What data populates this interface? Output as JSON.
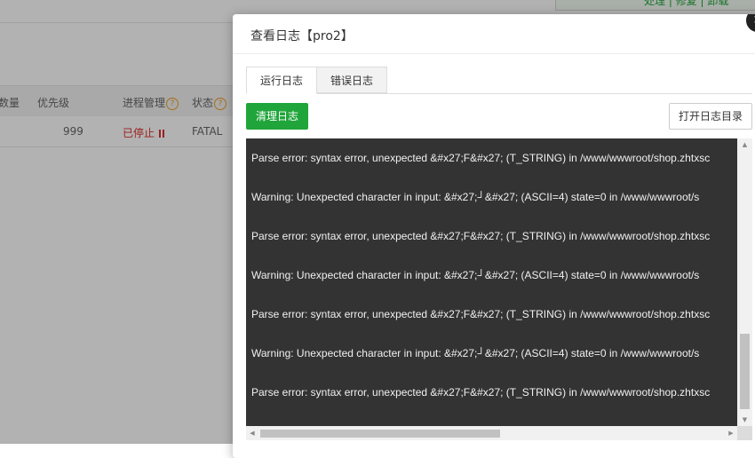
{
  "background": {
    "top_right_text": "处理 | 修复 | 卸载",
    "table": {
      "headers": [
        "数量",
        "优先级",
        "进程管理",
        "状态"
      ],
      "row": {
        "priority": "999",
        "process_status": "已停止",
        "state": "FATAL"
      }
    }
  },
  "modal": {
    "title": "查看日志【pro2】",
    "close_icon": "×",
    "tabs": [
      {
        "label": "运行日志",
        "active": true
      },
      {
        "label": "错误日志",
        "active": false
      }
    ],
    "clear_button": "清理日志",
    "open_dir_button": "打开日志目录",
    "log_lines": [
      "Parse error: syntax error, unexpected &#x27;F&#x27; (T_STRING) in /www/wwwroot/shop.zhtxsc",
      "Warning: Unexpected character in input:  &#x27;┘&#x27; (ASCII=4) state=0 in /www/wwwroot/s",
      "Parse error: syntax error, unexpected &#x27;F&#x27; (T_STRING) in /www/wwwroot/shop.zhtxsc",
      "Warning: Unexpected character in input:  &#x27;┘&#x27; (ASCII=4) state=0 in /www/wwwroot/s",
      "Parse error: syntax error, unexpected &#x27;F&#x27; (T_STRING) in /www/wwwroot/shop.zhtxsc",
      "Warning: Unexpected character in input:  &#x27;┘&#x27; (ASCII=4) state=0 in /www/wwwroot/s",
      "Parse error: syntax error, unexpected &#x27;F&#x27; (T_STRING) in /www/wwwroot/shop.zhtxsc"
    ]
  },
  "colors": {
    "accent_green": "#20a53a",
    "stopped_red": "#e02d2d",
    "log_background": "#333333",
    "help_icon_orange": "#f0a020"
  },
  "icons": {
    "help": "question-circle-icon",
    "paused": "pause-icon",
    "close": "close-icon"
  }
}
